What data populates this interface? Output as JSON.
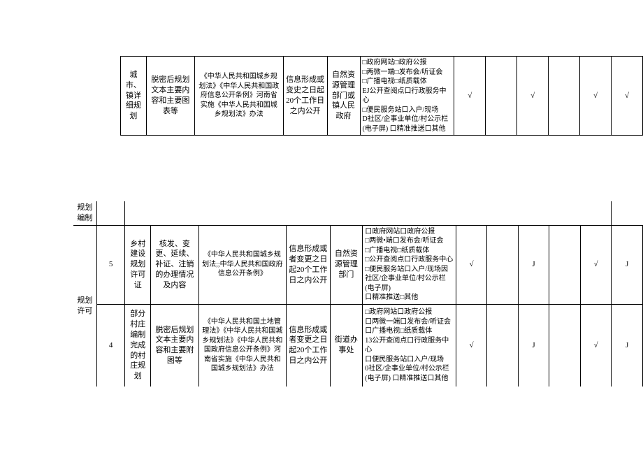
{
  "t1": {
    "c2": "城市、镇详细规划",
    "c3": "脱密后规划文本主要内容和主要图表等",
    "c4": "《中华人民共和国城乡规划法》《中华人民共和国政府信息公开条例》河南省实施《中华人民共和国城乡规划法》办法",
    "c5": "信息形成或变史之日起20个工作日之内公开",
    "c6": "自然资源管理部门或镇人民政府",
    "c7": "□政府网站□政府公报\n□两微一端□发布会/听证会\n□广播电视□纸质载体\nEJ公开查阅点口行政服务中心\n□便民服务站口入户/现场\nD社区/企事业单位/村公示栏\n(电子屏) 口精准推送口其他",
    "c8": "√",
    "c10": "√",
    "c12": "√",
    "c13": "√"
  },
  "header": {
    "a": "规划编制",
    "b": "规划许可"
  },
  "t2": {
    "c1": "5",
    "c2": "乡村建设规划许可证",
    "c3": "核发、变更、延续、补证、注销的办理情况及内容",
    "c4": "《中华人民共和国城乡规划法;;中华人民共和国政府信息公开条例》",
    "c5": "信息形成或者变更之日起20个工作日之内公开",
    "c6": "自然资源管理部门",
    "c7": "口政府网站口政府公报\n□两微•端口发布会/听证会\n□广播电视□纸质载体\n□公开查阅点口行政服务中心\n□便民服务站口入户/现场因社区/企事业单位/村公示栏(电子屏)\n口精准推送□其他",
    "c8": "√",
    "c10": "J",
    "c12": "√",
    "c13": "J"
  },
  "t3": {
    "c1": "4",
    "c2": "部分村庄编制完成的村庄规划",
    "c3": "脱密后规划文本主要内容和主要附图等",
    "c4": "《中华人民共和国土地管理法》《中华人民共和国城乡规划法》《中华人民共和国政府信息公开条例》河南省实施《中华人民共和国城乡规划法》办法",
    "c5": "信息形成或者变更之日起20个工作日之内公开",
    "c6": "街道办事处",
    "c7": "□政府网站口政府公报\n口两微一端口发布会/听证会\n口广播电视□纸质载体\n13公开查阅点口行政服务中心\n口便民服务站口入户/现场\n0社区/企事业单位/村公示栏\n(电子屏) 口精准推送口其他",
    "c8": "√",
    "c10": "J",
    "c12": "√",
    "c13": "J"
  }
}
